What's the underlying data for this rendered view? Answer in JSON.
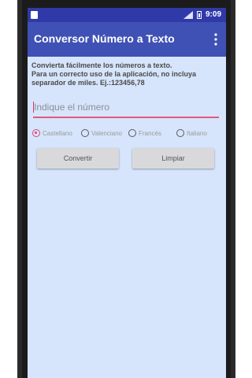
{
  "status_bar": {
    "time": "9:09"
  },
  "app_bar": {
    "title": "Conversor Número a Texto",
    "overflow_icon": "more-vert-icon"
  },
  "main": {
    "description_line1": "Convierta fácilmente los números a texto.",
    "description_line2": "Para un correcto uso de la aplicación, no incluya separador de miles. Ej.:123456,78",
    "number_input": {
      "placeholder": "Indique el número",
      "value": ""
    },
    "languages": [
      {
        "label": "Castellano",
        "selected": true
      },
      {
        "label": "Valenciano",
        "selected": false
      },
      {
        "label": "Francés",
        "selected": false
      },
      {
        "label": "Italiano",
        "selected": false
      }
    ],
    "convert_label": "Convertir",
    "clear_label": "Limpiar"
  },
  "colors": {
    "status_bar": "#3039a8",
    "app_bar": "#3f51b5",
    "background": "#d6e5fb",
    "accent": "#e0447a"
  }
}
